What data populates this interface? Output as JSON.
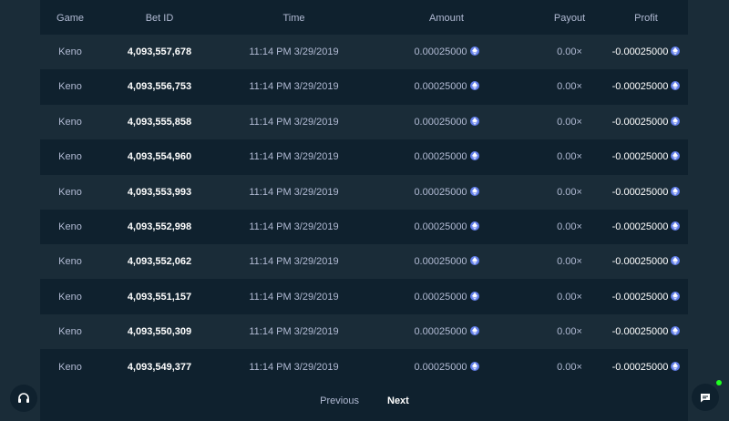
{
  "table": {
    "headers": {
      "game": "Game",
      "bet_id": "Bet ID",
      "time": "Time",
      "amount": "Amount",
      "payout": "Payout",
      "profit": "Profit"
    },
    "rows": [
      {
        "game": "Keno",
        "bet_id": "4,093,557,678",
        "time": "11:14 PM 3/29/2019",
        "amount": "0.00025000",
        "payout": "0.00×",
        "profit": "-0.00025000"
      },
      {
        "game": "Keno",
        "bet_id": "4,093,556,753",
        "time": "11:14 PM 3/29/2019",
        "amount": "0.00025000",
        "payout": "0.00×",
        "profit": "-0.00025000"
      },
      {
        "game": "Keno",
        "bet_id": "4,093,555,858",
        "time": "11:14 PM 3/29/2019",
        "amount": "0.00025000",
        "payout": "0.00×",
        "profit": "-0.00025000"
      },
      {
        "game": "Keno",
        "bet_id": "4,093,554,960",
        "time": "11:14 PM 3/29/2019",
        "amount": "0.00025000",
        "payout": "0.00×",
        "profit": "-0.00025000"
      },
      {
        "game": "Keno",
        "bet_id": "4,093,553,993",
        "time": "11:14 PM 3/29/2019",
        "amount": "0.00025000",
        "payout": "0.00×",
        "profit": "-0.00025000"
      },
      {
        "game": "Keno",
        "bet_id": "4,093,552,998",
        "time": "11:14 PM 3/29/2019",
        "amount": "0.00025000",
        "payout": "0.00×",
        "profit": "-0.00025000"
      },
      {
        "game": "Keno",
        "bet_id": "4,093,552,062",
        "time": "11:14 PM 3/29/2019",
        "amount": "0.00025000",
        "payout": "0.00×",
        "profit": "-0.00025000"
      },
      {
        "game": "Keno",
        "bet_id": "4,093,551,157",
        "time": "11:14 PM 3/29/2019",
        "amount": "0.00025000",
        "payout": "0.00×",
        "profit": "-0.00025000"
      },
      {
        "game": "Keno",
        "bet_id": "4,093,550,309",
        "time": "11:14 PM 3/29/2019",
        "amount": "0.00025000",
        "payout": "0.00×",
        "profit": "-0.00025000"
      },
      {
        "game": "Keno",
        "bet_id": "4,093,549,377",
        "time": "11:14 PM 3/29/2019",
        "amount": "0.00025000",
        "payout": "0.00×",
        "profit": "-0.00025000"
      }
    ],
    "currency_icon": "eth-coin-icon"
  },
  "pagination": {
    "previous_label": "Previous",
    "next_label": "Next"
  },
  "widgets": {
    "support_icon": "headset-icon",
    "chat_icon": "chat-bubble-icon",
    "chat_status": "online"
  },
  "colors": {
    "page_bg": "#1a2c38",
    "table_bg": "#0f212e",
    "row_alt_bg": "#1a2c38",
    "muted_text": "#b1bad3",
    "strong_text": "#ffffff",
    "coin": "#627eea",
    "online": "#1fff20"
  }
}
